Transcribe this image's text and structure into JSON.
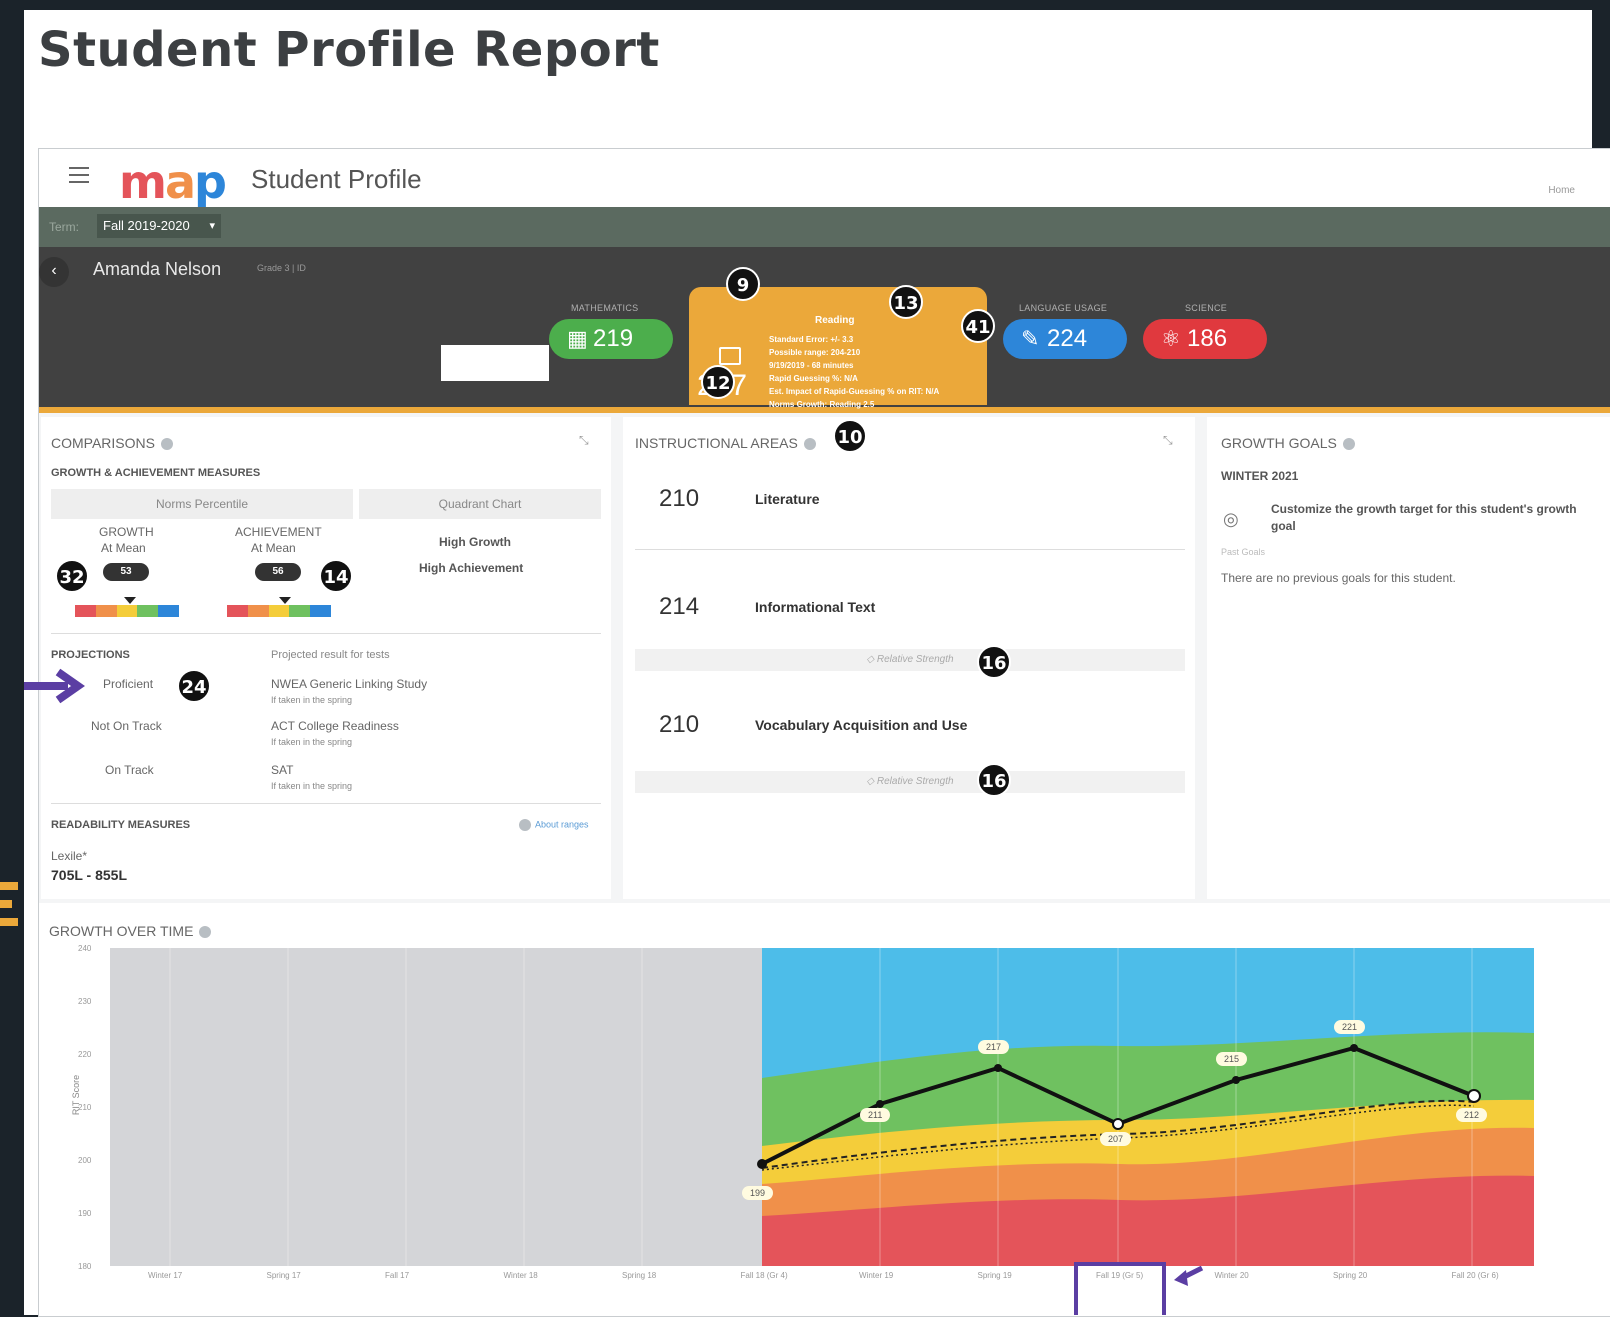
{
  "report_title": "Student Profile Report",
  "app": {
    "logo_text": "map",
    "title": "Student Profile",
    "home_link": "Home"
  },
  "term": {
    "label": "Term:",
    "value": "Fall 2019-2020"
  },
  "student": {
    "name": "Amanda Nelson",
    "meta": "Grade 3 | ID"
  },
  "subjects": {
    "math": {
      "label": "Mathematics",
      "score": "219",
      "color": "#4cae4c"
    },
    "reading": {
      "label": "Reading",
      "score": "207",
      "color": "#eba83a",
      "details": [
        "Standard Error: +/- 3.3",
        "Possible range: 204-210",
        "9/19/2019 - 68 minutes",
        "Rapid Guessing %: N/A",
        "Est. Impact of Rapid-Guessing % on RIT: N/A",
        "Norms Growth: Reading 2.5"
      ]
    },
    "language": {
      "label": "Language Usage",
      "score": "224",
      "color": "#2d86d9"
    },
    "science": {
      "label": "Science",
      "score": "186",
      "color": "#e0393e"
    }
  },
  "badges": {
    "b9": "9",
    "b13": "13",
    "b41": "41",
    "b12": "12",
    "b10": "10",
    "b32": "32",
    "b14": "14",
    "b24": "24",
    "b16a": "16",
    "b16b": "16"
  },
  "comparisons": {
    "title": "Comparisons",
    "subtitle": "Growth & Achievement Measures",
    "tab_norms": "Norms Percentile",
    "tab_quadrant": "Quadrant Chart",
    "growth_label": "Growth",
    "growth_sub": "At Mean",
    "growth_pct": "53",
    "achievement_label": "Achievement",
    "achievement_sub": "At Mean",
    "achievement_pct": "56",
    "quadrant_line1": "High Growth",
    "quadrant_line2": "High Achievement",
    "growth_level": 0.53,
    "achievement_level": 0.56,
    "projections_title": "Projections",
    "projections_header": "Projected result for tests",
    "projections": [
      {
        "result": "Proficient",
        "test": "NWEA Generic Linking Study",
        "note": "If taken in the spring"
      },
      {
        "result": "Not On Track",
        "test": "ACT College Readiness",
        "note": "If taken in the spring"
      },
      {
        "result": "On Track",
        "test": "SAT",
        "note": "If taken in the spring"
      }
    ],
    "readability_title": "Readability Measures",
    "readability_link": "About ranges",
    "lexile_label": "Lexile*",
    "lexile_value": "705L - 855L"
  },
  "instructional": {
    "title": "Instructional Areas",
    "areas": [
      {
        "score": "210",
        "name": "Literature"
      },
      {
        "score": "214",
        "name": "Informational Text"
      },
      {
        "score": "210",
        "name": "Vocabulary Acquisition and Use"
      }
    ],
    "relative_strength": "Relative Strength"
  },
  "goals": {
    "title": "Growth Goals",
    "term": "WINTER 2021",
    "customize_text": "Customize the growth target for this student's growth goal",
    "past_label": "Past Goals",
    "no_goals": "There are no previous goals for this student."
  },
  "growth": {
    "title": "Growth Over Time",
    "ylabel": "RIT Score",
    "yticks": [
      "240",
      "230",
      "220",
      "210",
      "200",
      "190",
      "180"
    ],
    "xticks": [
      "Winter 17",
      "Spring 17",
      "Fall 17",
      "Winter 18",
      "Spring 18",
      "Fall 18 (Gr 4)",
      "Winter 19",
      "Spring 19",
      "Fall 19 (Gr 5)",
      "Winter 20",
      "Spring 20",
      "Fall 20 (Gr 6)"
    ],
    "score_labels": [
      "199",
      "211",
      "217",
      "207",
      "215",
      "221",
      "212"
    ]
  },
  "colors": {
    "accent_purple": "#5b3ea3",
    "band_blue": "#4dbde9",
    "band_green": "#6fc160",
    "band_yellow": "#f4cd3a",
    "band_orange": "#f0904a",
    "band_red": "#e4545a"
  }
}
